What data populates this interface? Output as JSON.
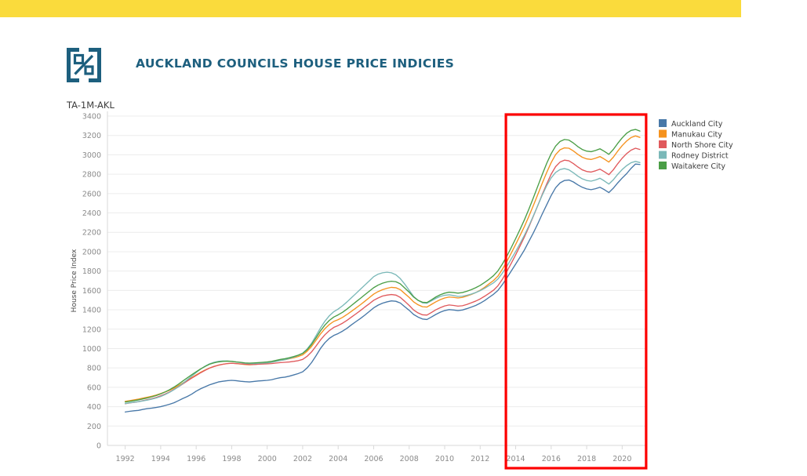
{
  "banner": {
    "color": "#fadb3c"
  },
  "header": {
    "title": "AUCKLAND COUNCILS HOUSE PRICE INDICIES",
    "logo_icon": "percent-in-brackets-icon",
    "logo_color": "#1d5f7e",
    "title_color": "#1d5f7e"
  },
  "chart_data": {
    "type": "line",
    "title": "TA-1M-AKL",
    "xlabel": "",
    "ylabel": "House Price Index",
    "ylim": [
      0,
      3400
    ],
    "xlim": [
      1991.0,
      2021.4
    ],
    "grid": true,
    "legend_position": "right",
    "ytick_labels": [
      "0",
      "200",
      "400",
      "600",
      "800",
      "1000",
      "1200",
      "1400",
      "1600",
      "1800",
      "2000",
      "2200",
      "2400",
      "2600",
      "2800",
      "3000",
      "3200",
      "3400"
    ],
    "xtick_labels": [
      "1992",
      "1994",
      "1996",
      "1998",
      "2000",
      "2002",
      "2004",
      "2006",
      "2008",
      "2010",
      "2012",
      "2014",
      "2016",
      "2018",
      "2020"
    ],
    "xticks": [
      1992,
      1994,
      1996,
      1998,
      2000,
      2002,
      2004,
      2006,
      2008,
      2010,
      2012,
      2014,
      2016,
      2018,
      2020
    ],
    "yticks": [
      0,
      200,
      400,
      600,
      800,
      1000,
      1200,
      1400,
      1600,
      1800,
      2000,
      2200,
      2400,
      2600,
      2800,
      3000,
      3200,
      3400
    ],
    "x": [
      1992.0,
      1992.25,
      1992.5,
      1992.75,
      1993.0,
      1993.25,
      1993.5,
      1993.75,
      1994.0,
      1994.25,
      1994.5,
      1994.75,
      1995.0,
      1995.25,
      1995.5,
      1995.75,
      1996.0,
      1996.25,
      1996.5,
      1996.75,
      1997.0,
      1997.25,
      1997.5,
      1997.75,
      1998.0,
      1998.25,
      1998.5,
      1998.75,
      1999.0,
      1999.25,
      1999.5,
      1999.75,
      2000.0,
      2000.25,
      2000.5,
      2000.75,
      2001.0,
      2001.25,
      2001.5,
      2001.75,
      2002.0,
      2002.25,
      2002.5,
      2002.75,
      2003.0,
      2003.25,
      2003.5,
      2003.75,
      2004.0,
      2004.25,
      2004.5,
      2004.75,
      2005.0,
      2005.25,
      2005.5,
      2005.75,
      2006.0,
      2006.25,
      2006.5,
      2006.75,
      2007.0,
      2007.25,
      2007.5,
      2007.75,
      2008.0,
      2008.25,
      2008.5,
      2008.75,
      2009.0,
      2009.25,
      2009.5,
      2009.75,
      2010.0,
      2010.25,
      2010.5,
      2010.75,
      2011.0,
      2011.25,
      2011.5,
      2011.75,
      2012.0,
      2012.25,
      2012.5,
      2012.75,
      2013.0,
      2013.25,
      2013.5,
      2013.75,
      2014.0,
      2014.25,
      2014.5,
      2014.75,
      2015.0,
      2015.25,
      2015.5,
      2015.75,
      2016.0,
      2016.25,
      2016.5,
      2016.75,
      2017.0,
      2017.25,
      2017.5,
      2017.75,
      2018.0,
      2018.25,
      2018.5,
      2018.75,
      2019.0,
      2019.25,
      2019.5,
      2019.75,
      2020.0,
      2020.25,
      2020.5,
      2020.75,
      2021.0
    ],
    "series": [
      {
        "name": "Auckland City",
        "color": "#4878a8",
        "values": [
          345,
          352,
          358,
          362,
          372,
          380,
          385,
          392,
          400,
          412,
          425,
          440,
          462,
          485,
          505,
          530,
          560,
          585,
          605,
          625,
          640,
          655,
          662,
          668,
          672,
          668,
          662,
          658,
          655,
          660,
          665,
          668,
          672,
          678,
          690,
          700,
          705,
          715,
          728,
          742,
          760,
          800,
          855,
          925,
          1000,
          1060,
          1105,
          1135,
          1155,
          1180,
          1210,
          1245,
          1278,
          1310,
          1345,
          1382,
          1420,
          1448,
          1468,
          1482,
          1492,
          1488,
          1470,
          1432,
          1395,
          1352,
          1325,
          1305,
          1300,
          1325,
          1352,
          1375,
          1392,
          1402,
          1398,
          1392,
          1398,
          1412,
          1428,
          1445,
          1468,
          1495,
          1528,
          1560,
          1600,
          1660,
          1728,
          1800,
          1872,
          1945,
          2020,
          2108,
          2195,
          2290,
          2390,
          2485,
          2580,
          2660,
          2710,
          2735,
          2740,
          2720,
          2690,
          2665,
          2648,
          2640,
          2650,
          2665,
          2640,
          2610,
          2655,
          2710,
          2760,
          2805,
          2860,
          2905,
          2900
        ]
      },
      {
        "name": "Manukau City",
        "color": "#f5921e",
        "values": [
          455,
          462,
          470,
          478,
          488,
          498,
          508,
          520,
          535,
          552,
          570,
          592,
          618,
          645,
          672,
          700,
          728,
          755,
          778,
          798,
          815,
          828,
          838,
          845,
          848,
          845,
          840,
          835,
          832,
          835,
          840,
          845,
          850,
          858,
          868,
          878,
          885,
          895,
          905,
          918,
          935,
          972,
          1022,
          1085,
          1150,
          1205,
          1248,
          1280,
          1298,
          1322,
          1352,
          1385,
          1418,
          1452,
          1488,
          1525,
          1562,
          1588,
          1608,
          1622,
          1632,
          1628,
          1608,
          1568,
          1528,
          1482,
          1452,
          1432,
          1428,
          1455,
          1482,
          1505,
          1522,
          1532,
          1528,
          1522,
          1528,
          1542,
          1558,
          1578,
          1602,
          1632,
          1668,
          1702,
          1748,
          1818,
          1898,
          1985,
          2075,
          2168,
          2262,
          2368,
          2478,
          2592,
          2708,
          2818,
          2920,
          3002,
          3052,
          3072,
          3068,
          3040,
          3005,
          2975,
          2958,
          2952,
          2965,
          2982,
          2955,
          2925,
          2975,
          3038,
          3095,
          3142,
          3178,
          3195,
          3180
        ]
      },
      {
        "name": "North Shore City",
        "color": "#e0595c",
        "values": [
          430,
          438,
          445,
          452,
          462,
          472,
          482,
          495,
          512,
          530,
          552,
          578,
          605,
          635,
          665,
          695,
          722,
          750,
          775,
          798,
          815,
          828,
          838,
          845,
          848,
          845,
          842,
          838,
          835,
          835,
          838,
          840,
          842,
          845,
          850,
          855,
          858,
          862,
          868,
          875,
          888,
          920,
          965,
          1025,
          1088,
          1142,
          1185,
          1218,
          1238,
          1262,
          1292,
          1325,
          1358,
          1392,
          1428,
          1462,
          1498,
          1522,
          1542,
          1552,
          1558,
          1552,
          1528,
          1488,
          1445,
          1398,
          1368,
          1348,
          1345,
          1372,
          1400,
          1422,
          1440,
          1450,
          1445,
          1438,
          1442,
          1455,
          1472,
          1490,
          1512,
          1540,
          1570,
          1602,
          1648,
          1715,
          1795,
          1880,
          1968,
          2060,
          2155,
          2258,
          2368,
          2478,
          2592,
          2700,
          2800,
          2878,
          2925,
          2945,
          2938,
          2910,
          2875,
          2845,
          2828,
          2822,
          2835,
          2852,
          2825,
          2795,
          2845,
          2908,
          2965,
          3012,
          3048,
          3068,
          3055
        ]
      },
      {
        "name": "Rodney District",
        "color": "#7ab8b8",
        "values": [
          432,
          440,
          446,
          452,
          460,
          468,
          478,
          490,
          505,
          525,
          548,
          575,
          605,
          640,
          678,
          715,
          752,
          788,
          818,
          842,
          858,
          868,
          872,
          872,
          868,
          862,
          855,
          848,
          845,
          845,
          848,
          850,
          852,
          858,
          868,
          878,
          885,
          898,
          912,
          930,
          952,
          995,
          1055,
          1132,
          1212,
          1282,
          1338,
          1380,
          1408,
          1442,
          1482,
          1525,
          1568,
          1612,
          1655,
          1698,
          1742,
          1768,
          1782,
          1788,
          1782,
          1762,
          1722,
          1665,
          1602,
          1538,
          1498,
          1472,
          1468,
          1492,
          1518,
          1538,
          1550,
          1555,
          1548,
          1538,
          1540,
          1550,
          1562,
          1578,
          1598,
          1622,
          1650,
          1678,
          1718,
          1778,
          1848,
          1925,
          2002,
          2085,
          2172,
          2268,
          2372,
          2478,
          2585,
          2682,
          2762,
          2818,
          2848,
          2858,
          2845,
          2815,
          2780,
          2752,
          2735,
          2728,
          2740,
          2758,
          2730,
          2698,
          2742,
          2798,
          2848,
          2888,
          2918,
          2932,
          2920
        ]
      },
      {
        "name": "Waitakere City",
        "color": "#4a9e46",
        "values": [
          448,
          455,
          462,
          470,
          480,
          490,
          502,
          515,
          532,
          552,
          575,
          602,
          632,
          665,
          698,
          730,
          760,
          790,
          815,
          838,
          852,
          862,
          868,
          870,
          868,
          862,
          858,
          852,
          850,
          852,
          855,
          858,
          862,
          868,
          878,
          888,
          895,
          905,
          918,
          932,
          950,
          988,
          1042,
          1110,
          1182,
          1242,
          1290,
          1325,
          1348,
          1375,
          1408,
          1445,
          1482,
          1518,
          1555,
          1592,
          1628,
          1655,
          1675,
          1688,
          1695,
          1690,
          1668,
          1625,
          1582,
          1532,
          1498,
          1478,
          1475,
          1502,
          1532,
          1555,
          1572,
          1582,
          1578,
          1572,
          1578,
          1592,
          1608,
          1628,
          1652,
          1682,
          1715,
          1752,
          1802,
          1872,
          1952,
          2042,
          2135,
          2232,
          2332,
          2442,
          2558,
          2678,
          2798,
          2912,
          3012,
          3090,
          3138,
          3158,
          3152,
          3122,
          3085,
          3055,
          3038,
          3032,
          3045,
          3062,
          3035,
          3005,
          3055,
          3118,
          3175,
          3222,
          3252,
          3262,
          3245
        ]
      }
    ],
    "annotation": {
      "type": "highlight-rectangle",
      "color": "#fd0000",
      "x_start": 2013.45,
      "x_end": 2021.35
    }
  }
}
